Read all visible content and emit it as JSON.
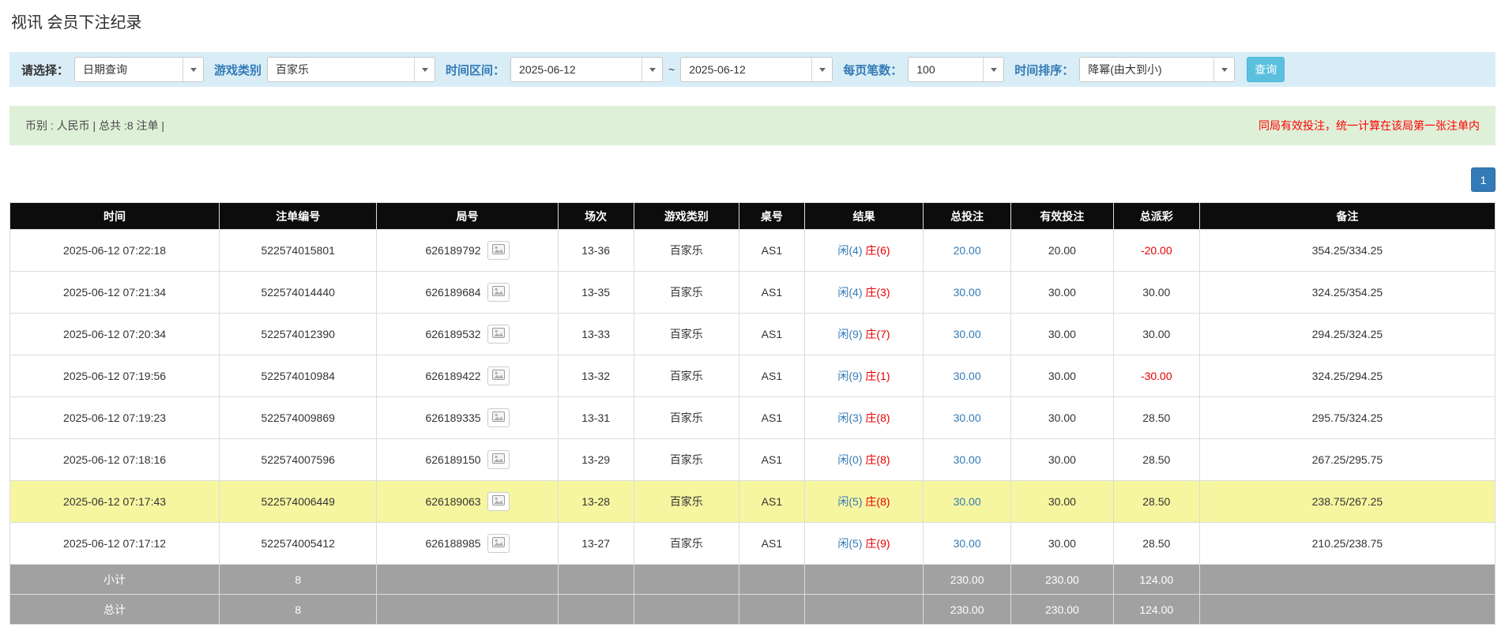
{
  "page_title": "视讯 会员下注纪录",
  "filter_bar": {
    "select_label": "请选择：",
    "query_type": {
      "value": "日期查询"
    },
    "game_type_label": "游戏类别",
    "game_type": {
      "value": "百家乐"
    },
    "time_range_label": "时间区间：",
    "date_from": {
      "value": "2025-06-12"
    },
    "tilde": "~",
    "date_to": {
      "value": "2025-06-12"
    },
    "page_size_label": "每页笔数：",
    "page_size": {
      "value": "100"
    },
    "sort_label": "时间排序：",
    "sort_order": {
      "value": "降幂(由大到小)"
    },
    "search_button_label": "查询"
  },
  "info_bar": {
    "summary": "币别 : 人民币 | 总共 :8 注单 |",
    "notice": "同局有效投注，统一计算在该局第一张注单内"
  },
  "pagination": {
    "current_page": "1"
  },
  "table": {
    "headers": [
      "时间",
      "注单编号",
      "局号",
      "场次",
      "游戏类别",
      "桌号",
      "结果",
      "总投注",
      "有效投注",
      "总派彩",
      "备注"
    ],
    "rows": [
      {
        "time": "2025-06-12 07:22:18",
        "bet_id": "522574015801",
        "round_id": "626189792",
        "session": "13-36",
        "game_type": "百家乐",
        "table_no": "AS1",
        "result_player": "闲(4)",
        "result_banker": "庄(6)",
        "total_bet": "20.00",
        "valid_bet": "20.00",
        "payout": "-20.00",
        "note": "354.25/334.25",
        "highlighted": false
      },
      {
        "time": "2025-06-12 07:21:34",
        "bet_id": "522574014440",
        "round_id": "626189684",
        "session": "13-35",
        "game_type": "百家乐",
        "table_no": "AS1",
        "result_player": "闲(4)",
        "result_banker": "庄(3)",
        "total_bet": "30.00",
        "valid_bet": "30.00",
        "payout": "30.00",
        "note": "324.25/354.25",
        "highlighted": false
      },
      {
        "time": "2025-06-12 07:20:34",
        "bet_id": "522574012390",
        "round_id": "626189532",
        "session": "13-33",
        "game_type": "百家乐",
        "table_no": "AS1",
        "result_player": "闲(9)",
        "result_banker": "庄(7)",
        "total_bet": "30.00",
        "valid_bet": "30.00",
        "payout": "30.00",
        "note": "294.25/324.25",
        "highlighted": false
      },
      {
        "time": "2025-06-12 07:19:56",
        "bet_id": "522574010984",
        "round_id": "626189422",
        "session": "13-32",
        "game_type": "百家乐",
        "table_no": "AS1",
        "result_player": "闲(9)",
        "result_banker": "庄(1)",
        "total_bet": "30.00",
        "valid_bet": "30.00",
        "payout": "-30.00",
        "note": "324.25/294.25",
        "highlighted": false
      },
      {
        "time": "2025-06-12 07:19:23",
        "bet_id": "522574009869",
        "round_id": "626189335",
        "session": "13-31",
        "game_type": "百家乐",
        "table_no": "AS1",
        "result_player": "闲(3)",
        "result_banker": "庄(8)",
        "total_bet": "30.00",
        "valid_bet": "30.00",
        "payout": "28.50",
        "note": "295.75/324.25",
        "highlighted": false
      },
      {
        "time": "2025-06-12 07:18:16",
        "bet_id": "522574007596",
        "round_id": "626189150",
        "session": "13-29",
        "game_type": "百家乐",
        "table_no": "AS1",
        "result_player": "闲(0)",
        "result_banker": "庄(8)",
        "total_bet": "30.00",
        "valid_bet": "30.00",
        "payout": "28.50",
        "note": "267.25/295.75",
        "highlighted": false
      },
      {
        "time": "2025-06-12 07:17:43",
        "bet_id": "522574006449",
        "round_id": "626189063",
        "session": "13-28",
        "game_type": "百家乐",
        "table_no": "AS1",
        "result_player": "闲(5)",
        "result_banker": "庄(8)",
        "total_bet": "30.00",
        "valid_bet": "30.00",
        "payout": "28.50",
        "note": "238.75/267.25",
        "highlighted": true
      },
      {
        "time": "2025-06-12 07:17:12",
        "bet_id": "522574005412",
        "round_id": "626188985",
        "session": "13-27",
        "game_type": "百家乐",
        "table_no": "AS1",
        "result_player": "闲(5)",
        "result_banker": "庄(9)",
        "total_bet": "30.00",
        "valid_bet": "30.00",
        "payout": "28.50",
        "note": "210.25/238.75",
        "highlighted": false
      }
    ],
    "subtotal_row": {
      "label": "小计",
      "count": "8",
      "total_bet": "230.00",
      "valid_bet": "230.00",
      "payout": "124.00"
    },
    "total_row": {
      "label": "总计",
      "count": "8",
      "total_bet": "230.00",
      "valid_bet": "230.00",
      "payout": "124.00"
    }
  },
  "colors": {
    "accent_blue": "#337ab7",
    "result_red": "#e60000",
    "notice_red": "#ff0000",
    "highlight_yellow": "#f7f6a0",
    "header_bg": "#0c0c0c",
    "footer_bg": "#a1a1a1",
    "filter_bg": "#d9edf7",
    "info_bg": "#dff0d8",
    "search_button_bg": "#5bc0de",
    "pagination_bg": "#337ab7"
  }
}
